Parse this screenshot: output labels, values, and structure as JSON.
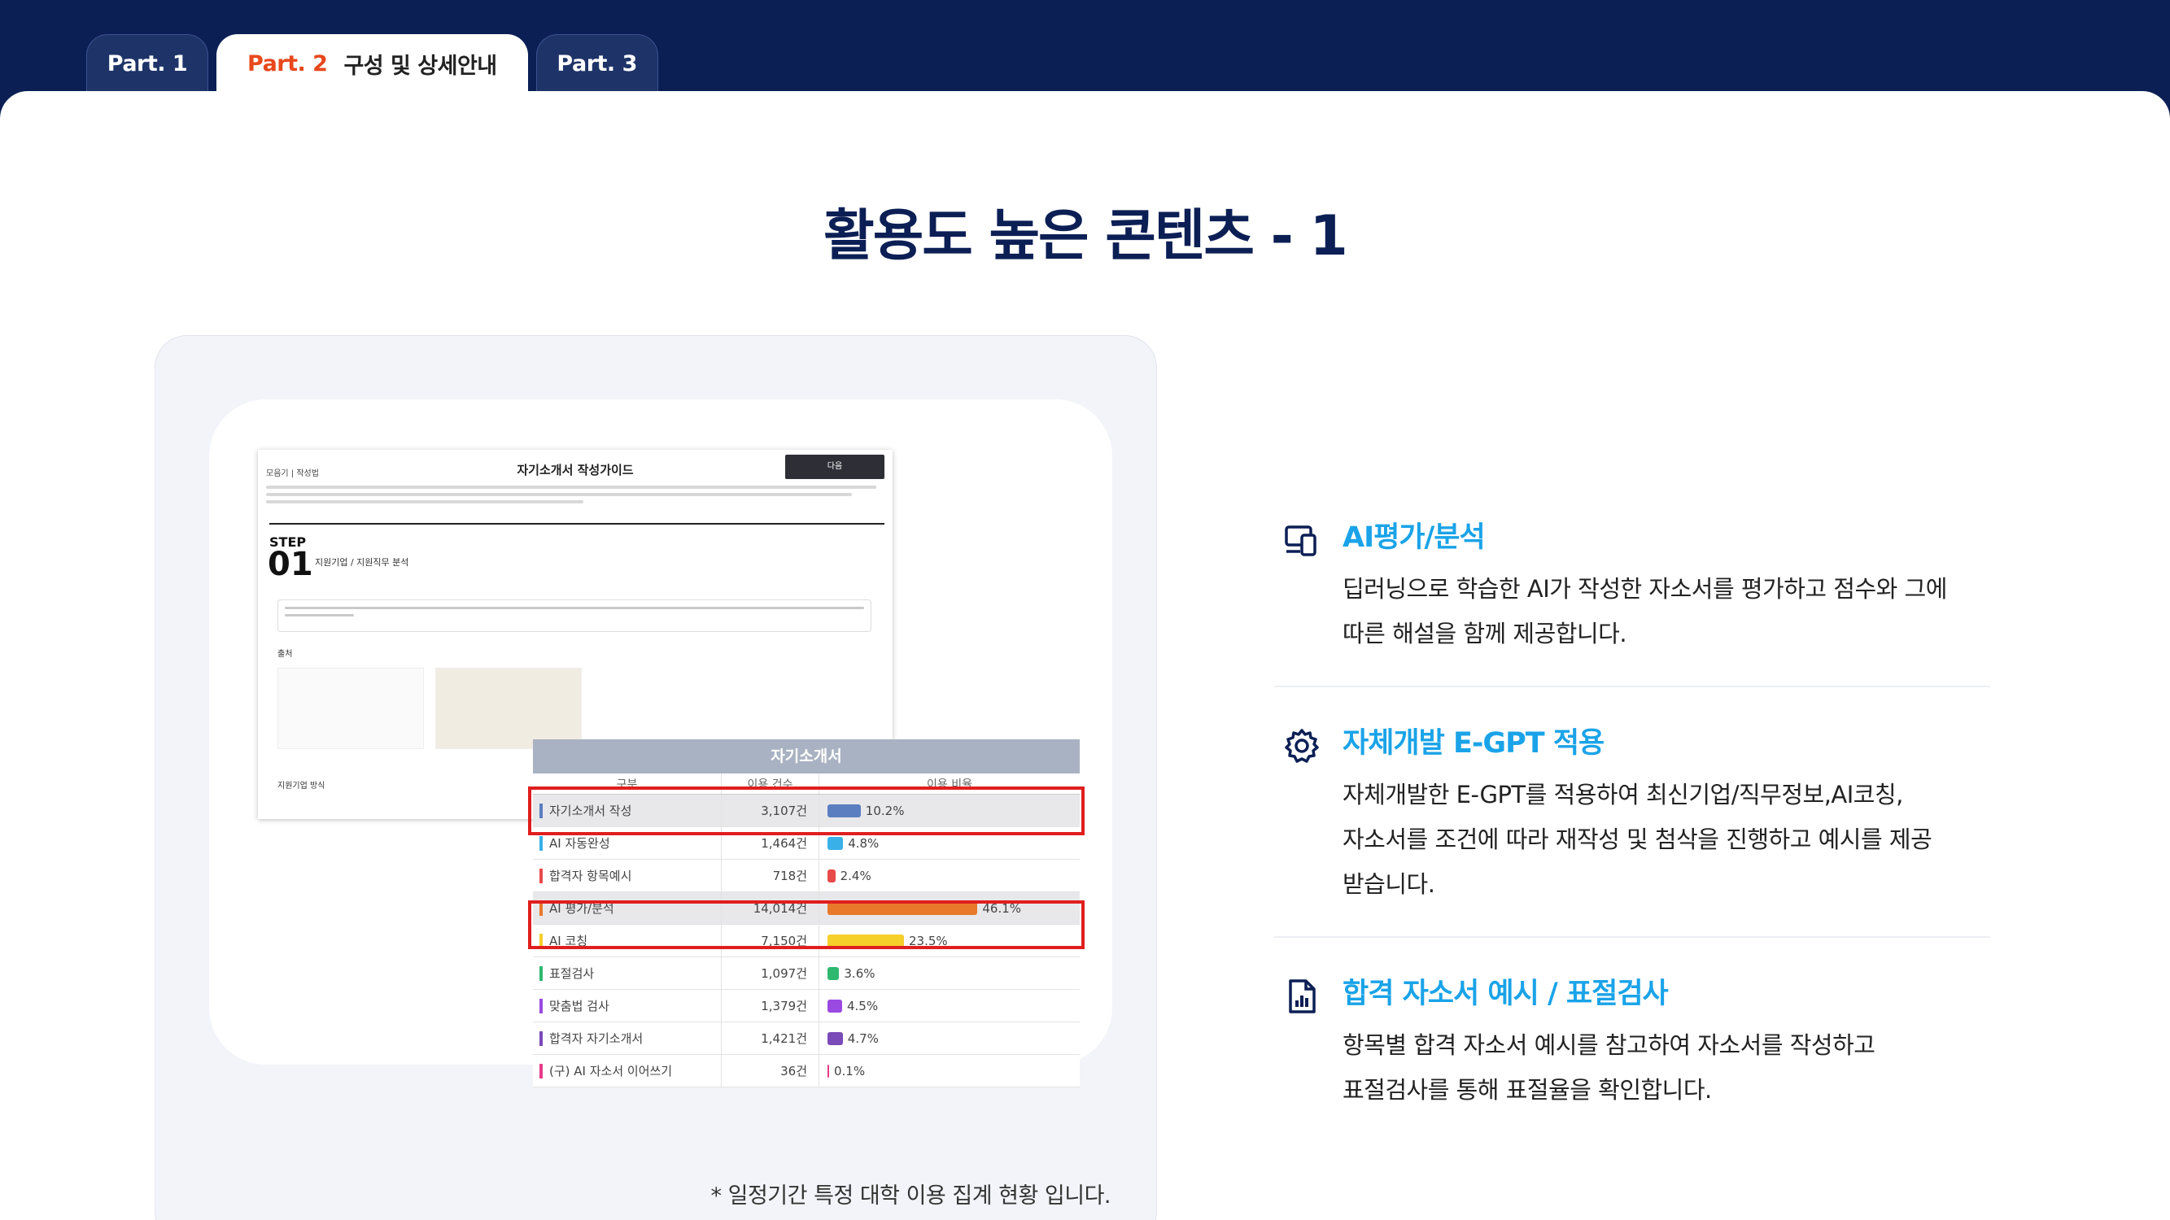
{
  "tabs": [
    {
      "label": "Part. 1"
    },
    {
      "part": "Part. 2",
      "label": "구성 및 상세안내"
    },
    {
      "label": "Part. 3"
    }
  ],
  "page_title": "활용도 높은 콘텐츠 - 1",
  "note": "* 일정기간 특정 대학 이용 집계 현황 입니다.",
  "screenshot": {
    "crumb": "모음기 | 작성법",
    "doc_title": "자기소개서 작성가이드",
    "button": "다음",
    "step": "STEP",
    "step_num": "01",
    "step_desc": "지원기업 / 지원직무 분석",
    "section1": "출처",
    "section2": "지원기업 방식",
    "table": {
      "title": "자기소개서",
      "headers": [
        "구분",
        "이용 건수",
        "이용 비율"
      ],
      "rows": [
        {
          "name": "자기소개서 작성",
          "count": "3,107건",
          "pct": "10.2%",
          "value": 10.2,
          "color": "#5a7ec0"
        },
        {
          "name": "AI 자동완성",
          "count": "1,464건",
          "pct": "4.8%",
          "value": 4.8,
          "color": "#3ab0e8"
        },
        {
          "name": "합격자 항목예시",
          "count": "718건",
          "pct": "2.4%",
          "value": 2.4,
          "color": "#e84a4a"
        },
        {
          "name": "AI 평가/분석",
          "count": "14,014건",
          "pct": "46.1%",
          "value": 46.1,
          "color": "#e8782a"
        },
        {
          "name": "AI 코칭",
          "count": "7,150건",
          "pct": "23.5%",
          "value": 23.5,
          "color": "#f5cf2a"
        },
        {
          "name": "표절검사",
          "count": "1,097건",
          "pct": "3.6%",
          "value": 3.6,
          "color": "#2eb870"
        },
        {
          "name": "맞춤법 검사",
          "count": "1,379건",
          "pct": "4.5%",
          "value": 4.5,
          "color": "#9a4ae0"
        },
        {
          "name": "합격자 자기소개서",
          "count": "1,421건",
          "pct": "4.7%",
          "value": 4.7,
          "color": "#7a4ab8"
        },
        {
          "name": "(구) AI 자소서 이어쓰기",
          "count": "36건",
          "pct": "0.1%",
          "value": 0.1,
          "color": "#e83a8a"
        }
      ]
    }
  },
  "features": [
    {
      "icon": "devices-icon",
      "title": "AI평가/분석",
      "lines": [
        "딥러닝으로 학습한 AI가 작성한 자소서를 평가하고 점수와 그에",
        "따른 해설을 함께 제공합니다."
      ]
    },
    {
      "icon": "gear-icon",
      "title": "자체개발 E-GPT 적용",
      "lines": [
        "자체개발한 E-GPT를 적용하여 최신기업/직무정보,AI코칭,",
        "자소서를 조건에 따라 재작성 및 첨삭을 진행하고 예시를 제공",
        "받습니다."
      ]
    },
    {
      "icon": "report-icon",
      "title": "합격 자소서 예시 / 표절검사",
      "lines": [
        "항목별 합격 자소서 예시를 참고하여 자소서를 작성하고",
        "표절검사를 통해 표절율을 확인합니다."
      ]
    }
  ]
}
